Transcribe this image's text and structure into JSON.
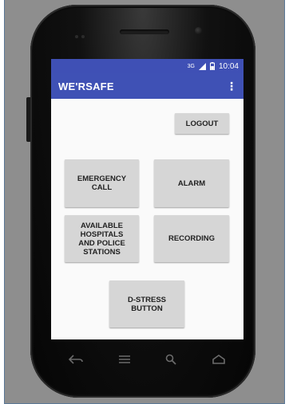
{
  "statusbar": {
    "network": "3G",
    "time": "10:04"
  },
  "appbar": {
    "title": "WE'RSAFE",
    "menu_icon": "overflow-menu-icon"
  },
  "buttons": {
    "logout": "LOGOUT",
    "emergency_call": "EMERGENCY\nCALL",
    "alarm": "ALARM",
    "hospitals": "AVAILABLE\nHOSPITALS\nAND POLICE\nSTATIONS",
    "recording": "RECORDING",
    "dstress": "D-STRESS\nBUTTON"
  },
  "colors": {
    "primary": "#3F51B5",
    "button": "#D6D6D6",
    "background": "#FAFAFA"
  },
  "navbar_icons": [
    "back-icon",
    "menu-icon",
    "search-icon",
    "home-icon"
  ]
}
